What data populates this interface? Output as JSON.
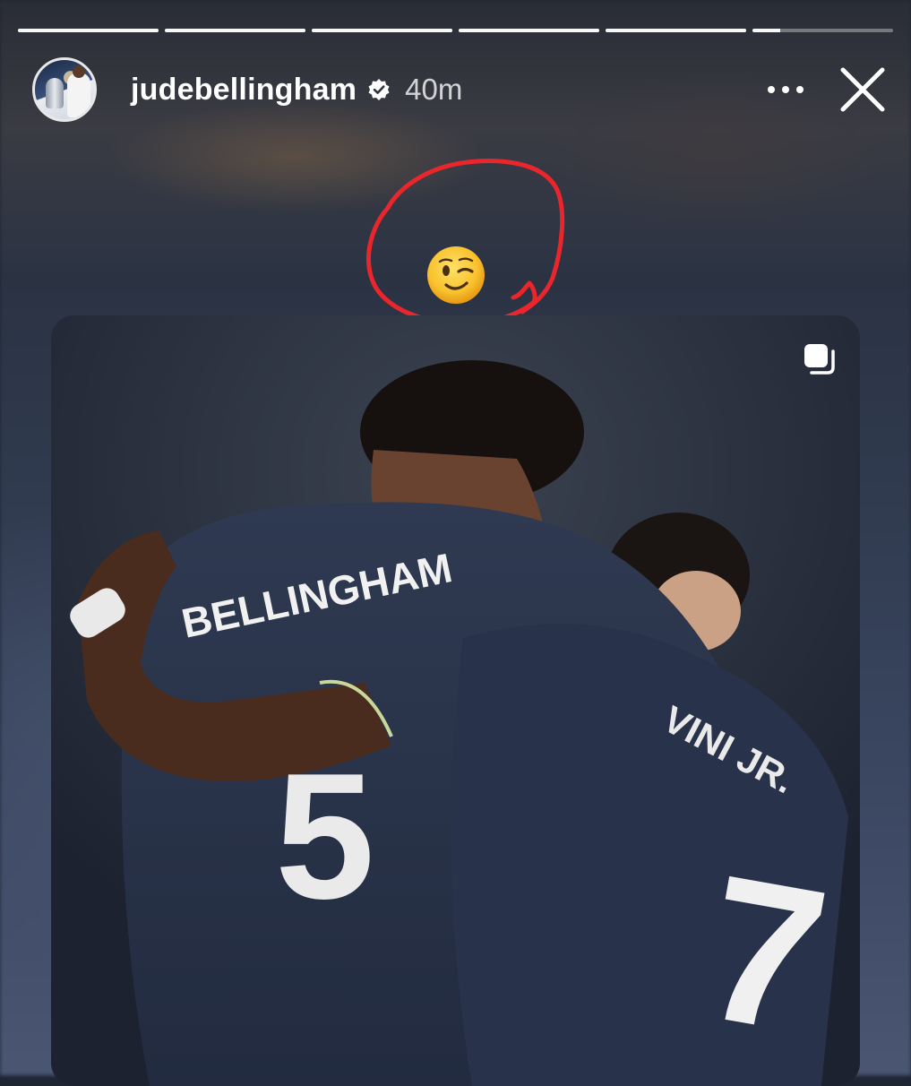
{
  "story": {
    "progress": [
      1,
      1,
      1,
      1,
      1,
      0.2
    ],
    "user": {
      "username": "judebellingham",
      "timestamp": "40m",
      "verified": true
    },
    "sticker_emoji": "😉",
    "annotation_color": "#e8262c",
    "shared_post": {
      "jersey_name_left": "BELLINGHAM",
      "jersey_number_left": "5",
      "jersey_name_right": "VINI JR.",
      "jersey_number_right": "7"
    }
  },
  "icons": {
    "verified": "verified-badge-icon",
    "more": "more-options-icon",
    "close": "close-icon",
    "multi_post": "carousel-post-icon"
  }
}
